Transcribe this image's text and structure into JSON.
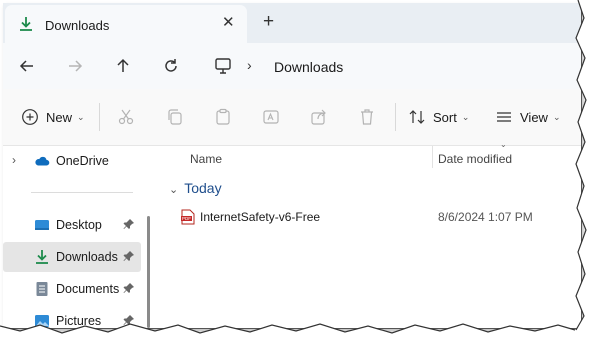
{
  "tab": {
    "title": "Downloads",
    "close_glyph": "✕",
    "new_tab_glyph": "+"
  },
  "nav": {
    "back_icon": "arrow-left-icon",
    "forward_icon": "arrow-right-icon",
    "up_icon": "arrow-up-icon",
    "refresh_icon": "refresh-icon",
    "address": {
      "location_icon": "this-pc-icon",
      "separator": "›",
      "path": "Downloads"
    }
  },
  "toolbar": {
    "new_label": "New",
    "sort_label": "Sort",
    "view_label": "View",
    "dropdown_glyph": "⌄"
  },
  "sidebar": {
    "items": [
      {
        "label": "OneDrive",
        "icon": "cloud-icon",
        "pinned": false,
        "expandable": true
      },
      {
        "label": "Desktop",
        "icon": "desktop-folder-icon",
        "pinned": true
      },
      {
        "label": "Downloads",
        "icon": "download-icon",
        "pinned": true,
        "selected": true
      },
      {
        "label": "Documents",
        "icon": "documents-folder-icon",
        "pinned": true
      },
      {
        "label": "Pictures",
        "icon": "pictures-folder-icon",
        "pinned": true
      }
    ],
    "expand_glyph": "›"
  },
  "content": {
    "columns": {
      "name": "Name",
      "date": "Date modified"
    },
    "sort_caret": "⌄",
    "groups": [
      {
        "label": "Today",
        "files": [
          {
            "name": "InternetSafety-v6-Free",
            "date": "8/6/2024 1:07 PM",
            "icon": "pdf-file-icon"
          }
        ]
      }
    ]
  },
  "colors": {
    "accent": "#1f4e8c",
    "download_green": "#1d8b4c",
    "onedrive_blue": "#0f6cbd",
    "selected_bg": "#e5e5e5"
  }
}
